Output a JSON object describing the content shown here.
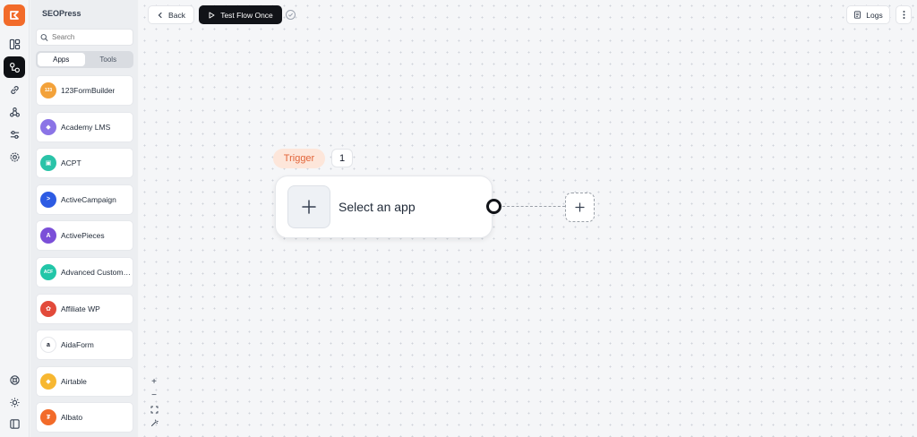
{
  "colors": {
    "brand": "#f26b2a",
    "dark": "#111318",
    "trigger_bg": "#fde6da",
    "trigger_fg": "#e2653a"
  },
  "rail": {
    "items": [
      {
        "icon": "dashboard-icon"
      },
      {
        "icon": "flows-icon",
        "active": true
      },
      {
        "icon": "link-icon"
      },
      {
        "icon": "webhook-icon"
      },
      {
        "icon": "sliders-icon"
      },
      {
        "icon": "gear-icon"
      }
    ],
    "bottom": [
      {
        "icon": "help-icon"
      },
      {
        "icon": "sun-icon"
      },
      {
        "icon": "collapse-icon"
      }
    ]
  },
  "panel": {
    "title": "SEOPress",
    "search_placeholder": "Search",
    "tabs": [
      {
        "label": "Apps",
        "active": true
      },
      {
        "label": "Tools"
      }
    ],
    "apps": [
      {
        "label": "123FormBuilder",
        "icon": "123formbuilder-icon",
        "color": "#f3a23a",
        "glyph": "123"
      },
      {
        "label": "Academy LMS",
        "icon": "academy-lms-icon",
        "color": "#8b74e6",
        "glyph": "◆"
      },
      {
        "label": "ACPT",
        "icon": "acpt-icon",
        "color": "#2ac3a8",
        "glyph": "▣"
      },
      {
        "label": "ActiveCampaign",
        "icon": "activecampaign-icon",
        "color": "#2d5be3",
        "glyph": ">"
      },
      {
        "label": "ActivePieces",
        "icon": "activepieces-icon",
        "color": "#7b4fd8",
        "glyph": "A"
      },
      {
        "label": "Advanced Custom Fields",
        "icon": "acf-icon",
        "color": "#22c6a8",
        "glyph": "ACF"
      },
      {
        "label": "Affiliate WP",
        "icon": "affiliate-wp-icon",
        "color": "#e24a3a",
        "glyph": "✿"
      },
      {
        "label": "AidaForm",
        "icon": "aidaform-icon",
        "color": "#ffffff",
        "glyph": "a"
      },
      {
        "label": "Airtable",
        "icon": "airtable-icon",
        "color": "#f7b731",
        "glyph": "◆"
      },
      {
        "label": "Albato",
        "icon": "albato-icon",
        "color": "#f26b2a",
        "glyph": "₮"
      }
    ]
  },
  "toolbar": {
    "back_label": "Back",
    "test_label": "Test Flow Once",
    "logs_label": "Logs"
  },
  "flow": {
    "trigger_label": "Trigger",
    "trigger_count": "1",
    "node_label": "Select an app"
  },
  "zoom": {
    "in": "+",
    "out": "−"
  }
}
